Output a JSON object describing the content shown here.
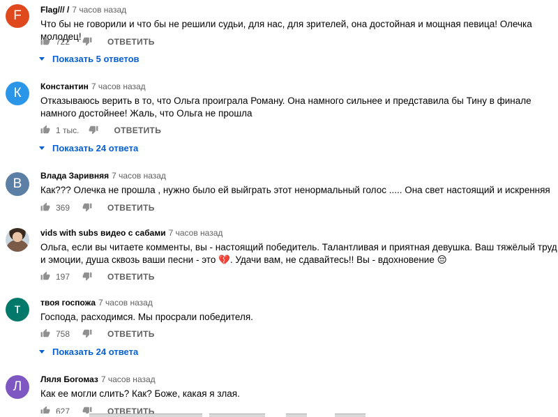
{
  "reply_label": "ОТВЕТИТЬ",
  "comments": [
    {
      "author": "Flag/// /",
      "time": "7 часов назад",
      "avatar_letter": "F",
      "avatar_color": "#e0491d",
      "text": "Что бы не говорили и что бы не решили судьи, для нас, для зрителей, она достойная и мощная певица! Олечка молодец!",
      "likes": "722",
      "replies": "Показать 5 ответов"
    },
    {
      "author": "Константин",
      "time": "7 часов назад",
      "avatar_letter": "К",
      "avatar_color": "#2a96e8",
      "text": "Отказываюсь верить в то, что Ольга проиграла Роману. Она намного сильнее и представила бы Тину в финале намного достойнее! Жаль, что Ольга не прошла",
      "likes": "1 тыс.",
      "replies": "Показать 24 ответа"
    },
    {
      "author": "Влада Заривняя",
      "time": "7 часов назад",
      "avatar_letter": "В",
      "avatar_color": "#5c7fa6",
      "text": "Как??? Олечка не прошла , нужно было ей выйграть этот ненормальный голос ..... Она свет настоящий и искренняя",
      "likes": "369"
    },
    {
      "author": "vids with subs видео с сабами",
      "time": "7 часов назад",
      "avatar_letter": "",
      "avatar_color": "#c9d6de",
      "text": "Ольга, если вы читаете комменты, вы - настоящий победитель. Талантливая и приятная девушка. Ваш тяжёлый труд и эмоции, душа сквозь ваши песни - это 💔. Удачи вам, не сдавайтесь!! Вы - вдохновение 😔",
      "likes": "197"
    },
    {
      "author": "твоя госпожа",
      "time": "7 часов назад",
      "avatar_letter": "т",
      "avatar_color": "#00796b",
      "text": "Господа, расходимся. Мы просрали победителя.",
      "likes": "758",
      "replies": "Показать 24 ответа"
    },
    {
      "author": "Ляля Богомаз",
      "time": "7 часов назад",
      "avatar_letter": "Л",
      "avatar_color": "#7e57c2",
      "text": "Как ее могли слить? Как? Боже, какая я злая.",
      "likes": "627"
    }
  ]
}
